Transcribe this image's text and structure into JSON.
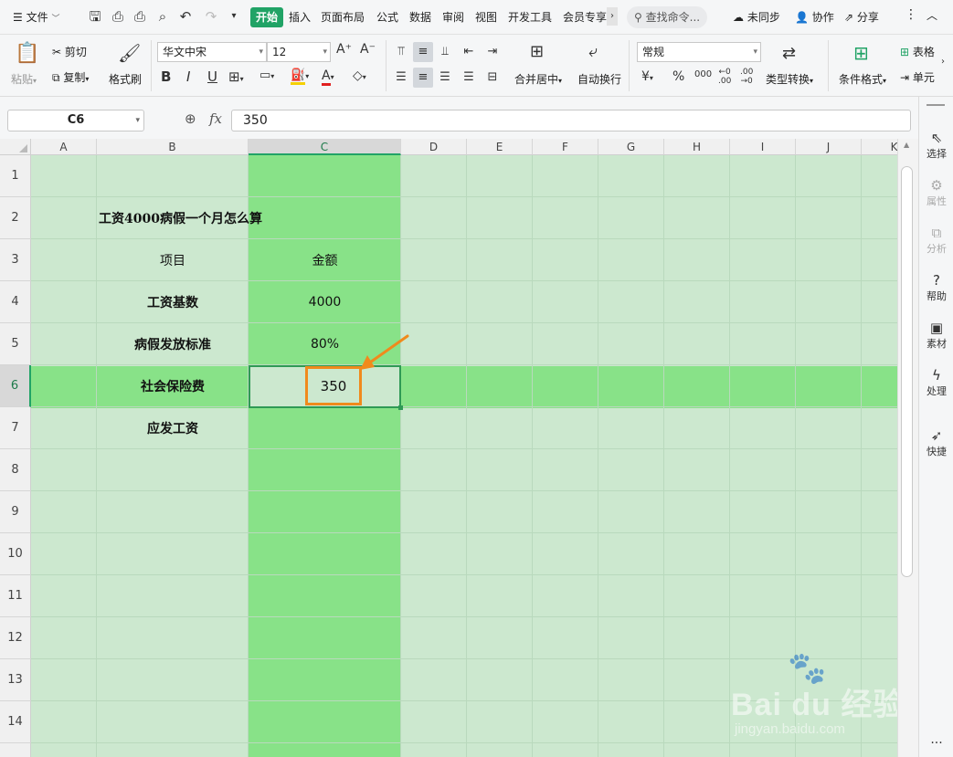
{
  "menu": {
    "file_label": "文件",
    "tabs": [
      "开始",
      "插入",
      "页面布局",
      "公式",
      "数据",
      "审阅",
      "视图",
      "开发工具",
      "会员专享"
    ],
    "search_placeholder": "查找命令...",
    "sync_label": "未同步",
    "collab_label": "协作",
    "share_label": "分享"
  },
  "ribbon": {
    "paste": "粘贴",
    "cut": "剪切",
    "copy": "复制",
    "format_painter": "格式刷",
    "font_name": "华文中宋",
    "font_size": "12",
    "merge_center": "合并居中",
    "wrap_text": "自动换行",
    "number_format": "常规",
    "type_convert": "类型转换",
    "cond_format": "条件格式",
    "table_style": "表格",
    "cell": "单元",
    "bold": "B",
    "italic": "I",
    "underline": "U"
  },
  "formula_bar": {
    "name_box": "C6",
    "fx": "fx",
    "value": "350"
  },
  "sheet": {
    "columns": [
      "A",
      "B",
      "C",
      "D",
      "E",
      "F",
      "G",
      "H",
      "I",
      "J",
      "K"
    ],
    "rows": [
      "1",
      "2",
      "3",
      "4",
      "5",
      "6",
      "7",
      "8",
      "9",
      "10",
      "11",
      "12",
      "13",
      "14"
    ],
    "title": "工资4000病假一个月怎么算",
    "header_item": "项目",
    "header_amount": "金额",
    "r4_label": "工资基数",
    "r4_value": "4000",
    "r5_label": "病假发放标准",
    "r5_value": "80%",
    "r6_label": "社会保险费",
    "r6_value": "350",
    "r7_label": "应发工资"
  },
  "sidebar": {
    "select": "选择",
    "properties": "属性",
    "analysis": "分析",
    "help": "帮助",
    "material": "素材",
    "process": "处理",
    "quick": "快捷"
  },
  "watermark": {
    "brand": "Bai du 经验",
    "url": "jingyan.baidu.com"
  },
  "colors": {
    "accent": "#21a366",
    "sheet_bg": "#cce8cf",
    "highlight": "#88e288",
    "annotation": "#f08a1c"
  }
}
